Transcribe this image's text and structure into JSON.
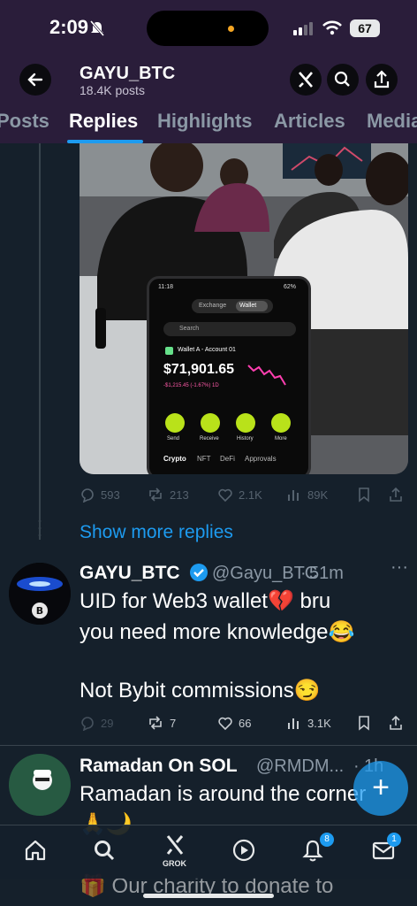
{
  "status_bar": {
    "time": "2:09",
    "battery": "67"
  },
  "header": {
    "name": "GAYU_BTC",
    "post_count": "18.4K posts"
  },
  "tabs": [
    {
      "label": "Posts"
    },
    {
      "label": "Replies"
    },
    {
      "label": "Highlights"
    },
    {
      "label": "Articles"
    },
    {
      "label": "Media"
    }
  ],
  "photo": {
    "phone_time": "11:18",
    "phone_battery": "62%",
    "toggle_exchange": "Exchange",
    "toggle_wallet": "Wallet",
    "search": "Search",
    "account": "Wallet A - Account 01",
    "balance": "$71,901.65",
    "change": "-$1,215.45 (-1.67%) 1D",
    "actions": [
      "Send",
      "Receive",
      "History",
      "More"
    ],
    "tabs": [
      "Crypto",
      "NFT",
      "DeFi",
      "Approvals"
    ]
  },
  "post1_actions": {
    "replies": "593",
    "reposts": "213",
    "likes": "2.1K",
    "views": "89K"
  },
  "show_more": "Show more replies",
  "tweet": {
    "name": "GAYU_BTC",
    "handle": "@Gayu_BTC",
    "time": "51m",
    "line1": "UID for Web3 wallet💔 bru",
    "line2": "you need more knowledge😂",
    "line3": "Not Bybit commissions😏",
    "replies": "29",
    "reposts": "7",
    "likes": "66",
    "views": "3.1K"
  },
  "tweet2": {
    "name": "Ramadan On SOL",
    "handle": "@RMDM...",
    "time": "1h",
    "line1": "Ramadan is around the corner",
    "line2": "🙏🌙",
    "line3": "🎁 Our charity to donate to"
  },
  "nav": {
    "grok_label": "GROK",
    "notif_count": "8",
    "msg_count": "1"
  },
  "colors": {
    "accent": "#1d9bf0",
    "header_bg": "#2a1d3a",
    "page_bg": "#15202b"
  }
}
